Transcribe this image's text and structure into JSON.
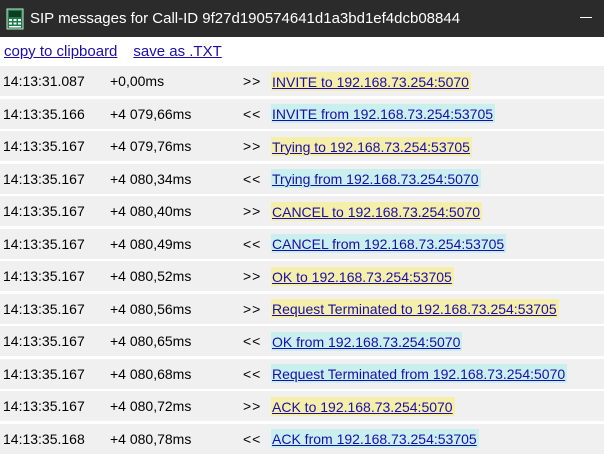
{
  "window": {
    "title": "SIP messages for Call-ID 9f27d190574641d1a3bd1ef4dcb08844",
    "app_icon": "sip-app-icon",
    "minimize_icon": "minimize-icon"
  },
  "links": {
    "copy": "copy to clipboard",
    "save": "save as .TXT"
  },
  "colors": {
    "outgoing_highlight": "#f5efaa",
    "incoming_highlight": "#c9efef",
    "link": "#1a0dab",
    "row_bg": "#f0f0f0",
    "titlebar_bg": "#2b2b2b"
  },
  "rows": [
    {
      "time": "14:13:31.087",
      "delta": "+0,00ms",
      "dir": ">>",
      "msg": "INVITE to 192.168.73.254:5070",
      "kind": "out"
    },
    {
      "time": "14:13:35.166",
      "delta": "+4 079,66ms",
      "dir": "<<",
      "msg": "INVITE from 192.168.73.254:53705",
      "kind": "in"
    },
    {
      "time": "14:13:35.167",
      "delta": "+4 079,76ms",
      "dir": ">>",
      "msg": "Trying to 192.168.73.254:53705",
      "kind": "out"
    },
    {
      "time": "14:13:35.167",
      "delta": "+4 080,34ms",
      "dir": "<<",
      "msg": "Trying from 192.168.73.254:5070",
      "kind": "in"
    },
    {
      "time": "14:13:35.167",
      "delta": "+4 080,40ms",
      "dir": ">>",
      "msg": "CANCEL to 192.168.73.254:5070",
      "kind": "out"
    },
    {
      "time": "14:13:35.167",
      "delta": "+4 080,49ms",
      "dir": "<<",
      "msg": "CANCEL from 192.168.73.254:53705",
      "kind": "in"
    },
    {
      "time": "14:13:35.167",
      "delta": "+4 080,52ms",
      "dir": ">>",
      "msg": "OK to 192.168.73.254:53705",
      "kind": "out"
    },
    {
      "time": "14:13:35.167",
      "delta": "+4 080,56ms",
      "dir": ">>",
      "msg": "Request Terminated to 192.168.73.254:53705",
      "kind": "out"
    },
    {
      "time": "14:13:35.167",
      "delta": "+4 080,65ms",
      "dir": "<<",
      "msg": "OK from 192.168.73.254:5070",
      "kind": "in"
    },
    {
      "time": "14:13:35.167",
      "delta": "+4 080,68ms",
      "dir": "<<",
      "msg": "Request Terminated from 192.168.73.254:5070",
      "kind": "in"
    },
    {
      "time": "14:13:35.167",
      "delta": "+4 080,72ms",
      "dir": ">>",
      "msg": "ACK to 192.168.73.254:5070",
      "kind": "out"
    },
    {
      "time": "14:13:35.168",
      "delta": "+4 080,78ms",
      "dir": "<<",
      "msg": "ACK from 192.168.73.254:53705",
      "kind": "in"
    }
  ]
}
